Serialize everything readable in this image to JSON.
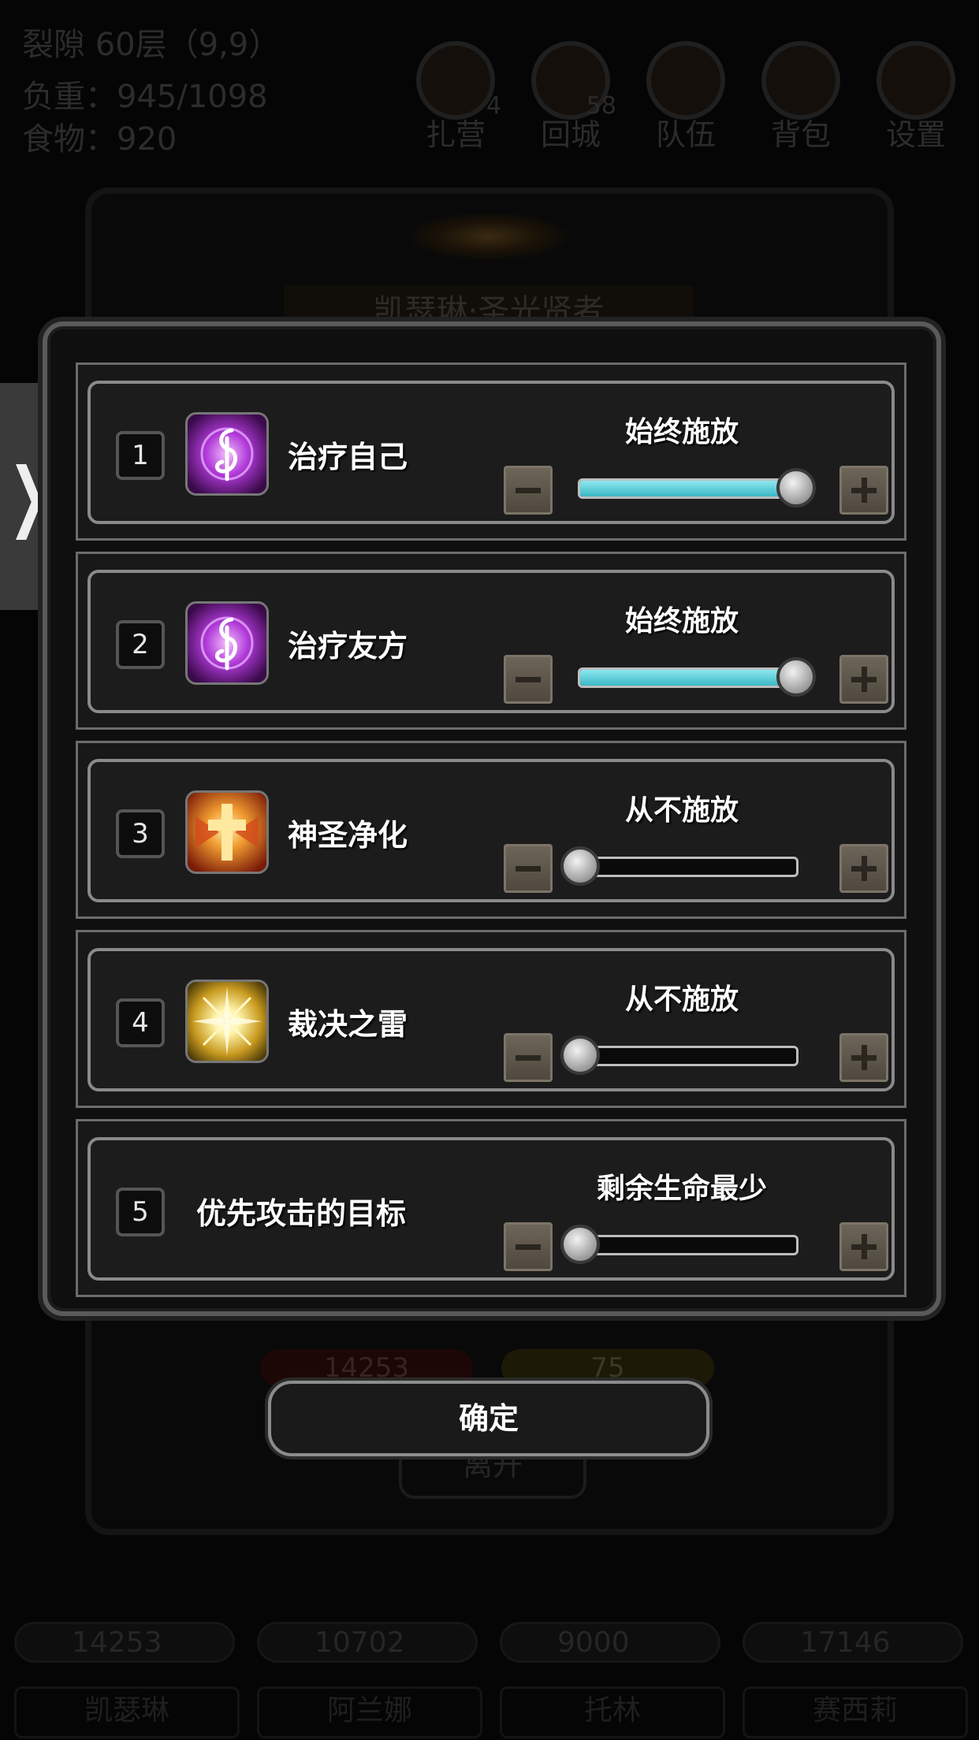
{
  "background": {
    "location": "裂隙 60层（9,9）",
    "weight": "负重：945/1098",
    "food": "食物：920",
    "hud": [
      {
        "label": "扎营",
        "badge": "4",
        "icon": "tent-icon"
      },
      {
        "label": "回城",
        "badge": "58",
        "icon": "portal-icon"
      },
      {
        "label": "队伍",
        "badge": "",
        "icon": "team-icon"
      },
      {
        "label": "背包",
        "badge": "",
        "icon": "backpack-icon"
      },
      {
        "label": "设置",
        "badge": "",
        "icon": "gear-icon"
      }
    ],
    "hero_name": "凯瑟琳·圣光贤者",
    "hp": "14253",
    "energy": "75",
    "leave_label": "离开",
    "team_values": [
      "14253",
      "10702",
      "9000",
      "17146"
    ],
    "team_names": [
      "凯瑟琳",
      "阿兰娜",
      "托林",
      "赛西莉"
    ]
  },
  "side_tab": {
    "glyph": "❯",
    "icon": "chevron-right-icon"
  },
  "rows": [
    {
      "num": "1",
      "name": "治疗自己",
      "mode": "始终施放",
      "level": 1.0,
      "icon": "heal-rune-icon"
    },
    {
      "num": "2",
      "name": "治疗友方",
      "mode": "始终施放",
      "level": 1.0,
      "icon": "heal-rune-icon"
    },
    {
      "num": "3",
      "name": "神圣净化",
      "mode": "从不施放",
      "level": 0.0,
      "icon": "holy-cross-icon"
    },
    {
      "num": "4",
      "name": "裁决之雷",
      "mode": "从不施放",
      "level": 0.0,
      "icon": "thunder-burst-icon"
    },
    {
      "num": "5",
      "name": "优先攻击的目标",
      "mode": "剩余生命最少",
      "level": 0.0,
      "icon": ""
    }
  ],
  "confirm_label": "确定",
  "colors": {
    "slider_fill": "#4cc4d0",
    "panel_bg": "#181818",
    "stepper": "#5f584c"
  }
}
